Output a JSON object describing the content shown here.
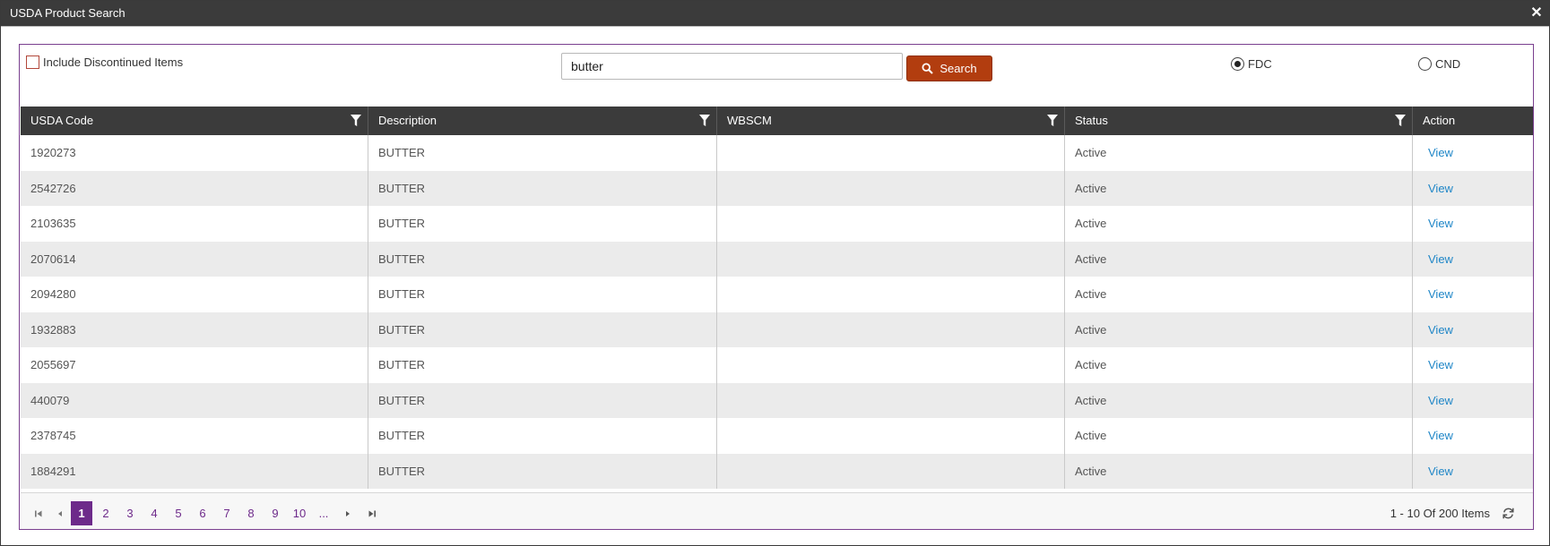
{
  "window": {
    "title": "USDA Product Search",
    "close_glyph": "✕"
  },
  "filters": {
    "include_discontinued_label": "Include Discontinued Items",
    "include_discontinued_checked": false,
    "search_value": "butter",
    "search_button_label": "Search",
    "source_options": [
      {
        "label": "FDC",
        "selected": true
      },
      {
        "label": "CND",
        "selected": false
      }
    ]
  },
  "grid": {
    "columns": [
      "USDA Code",
      "Description",
      "WBSCM",
      "Status",
      "Action"
    ],
    "rows": [
      {
        "usda_code": "1920273",
        "description": "BUTTER",
        "wbscm": "",
        "status": "Active",
        "action": "View"
      },
      {
        "usda_code": "2542726",
        "description": "BUTTER",
        "wbscm": "",
        "status": "Active",
        "action": "View"
      },
      {
        "usda_code": "2103635",
        "description": "BUTTER",
        "wbscm": "",
        "status": "Active",
        "action": "View"
      },
      {
        "usda_code": "2070614",
        "description": "BUTTER",
        "wbscm": "",
        "status": "Active",
        "action": "View"
      },
      {
        "usda_code": "2094280",
        "description": "BUTTER",
        "wbscm": "",
        "status": "Active",
        "action": "View"
      },
      {
        "usda_code": "1932883",
        "description": "BUTTER",
        "wbscm": "",
        "status": "Active",
        "action": "View"
      },
      {
        "usda_code": "2055697",
        "description": "BUTTER",
        "wbscm": "",
        "status": "Active",
        "action": "View"
      },
      {
        "usda_code": "440079",
        "description": "BUTTER",
        "wbscm": "",
        "status": "Active",
        "action": "View"
      },
      {
        "usda_code": "2378745",
        "description": "BUTTER",
        "wbscm": "",
        "status": "Active",
        "action": "View"
      },
      {
        "usda_code": "1884291",
        "description": "BUTTER",
        "wbscm": "",
        "status": "Active",
        "action": "View"
      }
    ]
  },
  "pager": {
    "pages": [
      "1",
      "2",
      "3",
      "4",
      "5",
      "6",
      "7",
      "8",
      "9",
      "10",
      "..."
    ],
    "current_page": "1",
    "info": "1 - 10 Of 200 Items"
  },
  "colors": {
    "header_bg": "#3b3b3b",
    "accent_purple": "#6d2a8a",
    "search_button": "#b23d0f",
    "link_blue": "#1f86c7"
  }
}
